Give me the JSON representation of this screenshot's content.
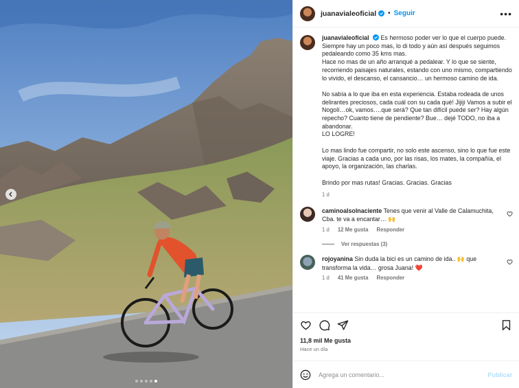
{
  "header": {
    "username": "juanavialeoficial",
    "separator": "•",
    "follow_label": "Seguir",
    "more_label": "•••"
  },
  "caption": {
    "username": "juanavialeoficial",
    "paragraphs": [
      "Es hermoso poder ver lo que el cuerpo puede. Siempre hay un poco mas, lo di todo y aún así después seguimos pedaleando como 35 kms mas.\nHace no mas de un año arranqué a pedalear. Y lo que se siente, recorriendo paisajes naturales, estando con uno mismo, compartiendo lo vivido, el descanso, el cansancio… un hermoso camino de ida.",
      "No sabía a lo que iba en esta experiencia. Estaba rodeada de unos delirantes preciosos, cada cuál con su cada qué! Jijiji Vamos a subir el Nogolí…ok, vamos….que será? Que tan difícil puede ser? Hay algún repecho? Cuanto tiene de pendiente? Bue… dejé TODO, no iba a abandonar.\nLO LOGRE!",
      "Lo mas lindo fue compartir, no solo este ascenso, sino lo que fue este viaje. Gracias a cada uno, por las risas, los mates, la compañía, el apoyo, la organización, las charlas.",
      "Brindo por mas rutas! Gracias. Gracias. Gracias"
    ],
    "time": "1 d"
  },
  "comments": [
    {
      "username": "caminoalsolnaciente",
      "text": "Tenes que venir al Valle de Calamuchita, Cba. te va a encantar… 🙌",
      "time": "1 d",
      "likes": "12 Me gusta",
      "reply": "Responder",
      "view_replies": "Ver respuestas (3)"
    },
    {
      "username": "rojoyanina",
      "text": "Sin duda la bici es un camino de ida.. 🙌 que transforma la vida… grosa Juana! ❤️",
      "time": "1 d",
      "likes": "41 Me gusta",
      "reply": "Responder"
    }
  ],
  "likes_count": "11,8 mil Me gusta",
  "posted": "Hace un día",
  "comment_box": {
    "placeholder": "Agrega un comentario...",
    "publish_label": "Publicar"
  },
  "icons": {
    "like": "heart-icon",
    "comment": "comment-icon",
    "share": "share-icon",
    "save": "bookmark-icon",
    "emoji": "emoji-icon",
    "verified": "verified-badge-icon",
    "prev": "chevron-left-icon"
  },
  "colors": {
    "accent": "#0095f6",
    "verified": "#0095f6",
    "publish_disabled": "#b2dffc"
  },
  "carousel": {
    "slides": 5,
    "active": 5
  }
}
